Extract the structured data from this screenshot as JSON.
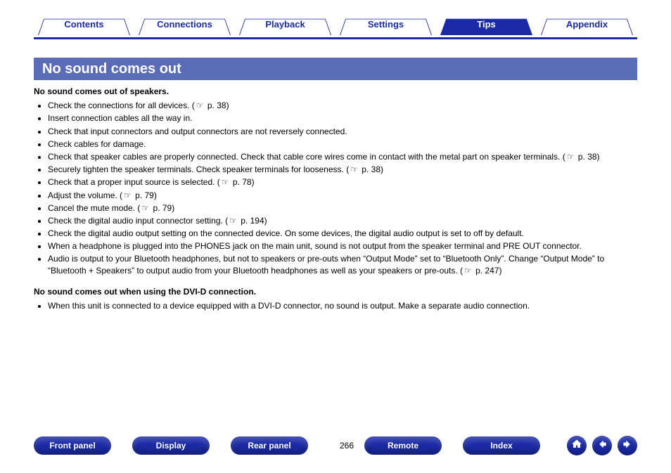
{
  "tabs": [
    {
      "label": "Contents",
      "active": false
    },
    {
      "label": "Connections",
      "active": false
    },
    {
      "label": "Playback",
      "active": false
    },
    {
      "label": "Settings",
      "active": false
    },
    {
      "label": "Tips",
      "active": true
    },
    {
      "label": "Appendix",
      "active": false
    }
  ],
  "title": "No sound comes out",
  "sections": [
    {
      "heading": "No sound comes out of speakers.",
      "items": [
        {
          "text": "Check the connections for all devices.  (",
          "ref": "p. 38",
          "tail": ")"
        },
        {
          "text": "Insert connection cables all the way in."
        },
        {
          "text": "Check that input connectors and output connectors are not reversely connected."
        },
        {
          "text": "Check cables for damage."
        },
        {
          "text": "Check that speaker cables are properly connected. Check that cable core wires come in contact with the metal part on speaker terminals.  (",
          "ref": "p. 38",
          "tail": ")"
        },
        {
          "text": "Securely tighten the speaker terminals. Check speaker terminals for looseness.  (",
          "ref": "p. 38",
          "tail": ")"
        },
        {
          "text": "Check that a proper input source is selected.  (",
          "ref": "p. 78",
          "tail": ")"
        },
        {
          "text": "Adjust the volume.  (",
          "ref": "p. 79",
          "tail": ")"
        },
        {
          "text": "Cancel the mute mode.  (",
          "ref": "p. 79",
          "tail": ")"
        },
        {
          "text": "Check the digital audio input connector setting.  (",
          "ref": "p. 194",
          "tail": ")"
        },
        {
          "text": "Check the digital audio output setting on the connected device. On some devices, the digital audio output is set to off by default."
        },
        {
          "text": "When a headphone is plugged into the PHONES jack on the main unit, sound is not output from the speaker terminal and PRE OUT connector."
        },
        {
          "text": "Audio is output to your Bluetooth headphones, but not to speakers or pre-outs when “Output Mode” set to “Bluetooth Only”. Change “Output Mode” to “Bluetooth + Speakers” to output audio from your Bluetooth headphones as well as your speakers or pre-outs.  (",
          "ref": "p. 247",
          "tail": ")"
        }
      ]
    },
    {
      "heading": "No sound comes out when using the DVI-D connection.",
      "items": [
        {
          "text": "When this unit is connected to a device equipped with a DVI-D connector, no sound is output. Make a separate audio connection."
        }
      ]
    }
  ],
  "bottom": {
    "buttons": [
      "Front panel",
      "Display",
      "Rear panel"
    ],
    "page_no": "266",
    "buttons2": [
      "Remote",
      "Index"
    ]
  },
  "ref_glyph": "☞"
}
